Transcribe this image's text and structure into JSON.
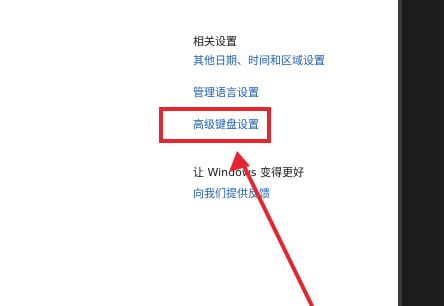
{
  "related_settings": {
    "heading": "相关设置",
    "links": {
      "datetime": "其他日期、时间和区域设置",
      "language": "管理语言设置",
      "keyboard": "高级键盘设置"
    }
  },
  "improve_windows": {
    "heading": "让 Windows 变得更好",
    "feedback_link": "向我们提供反馈"
  },
  "annotation": {
    "color": "#e6262f"
  }
}
